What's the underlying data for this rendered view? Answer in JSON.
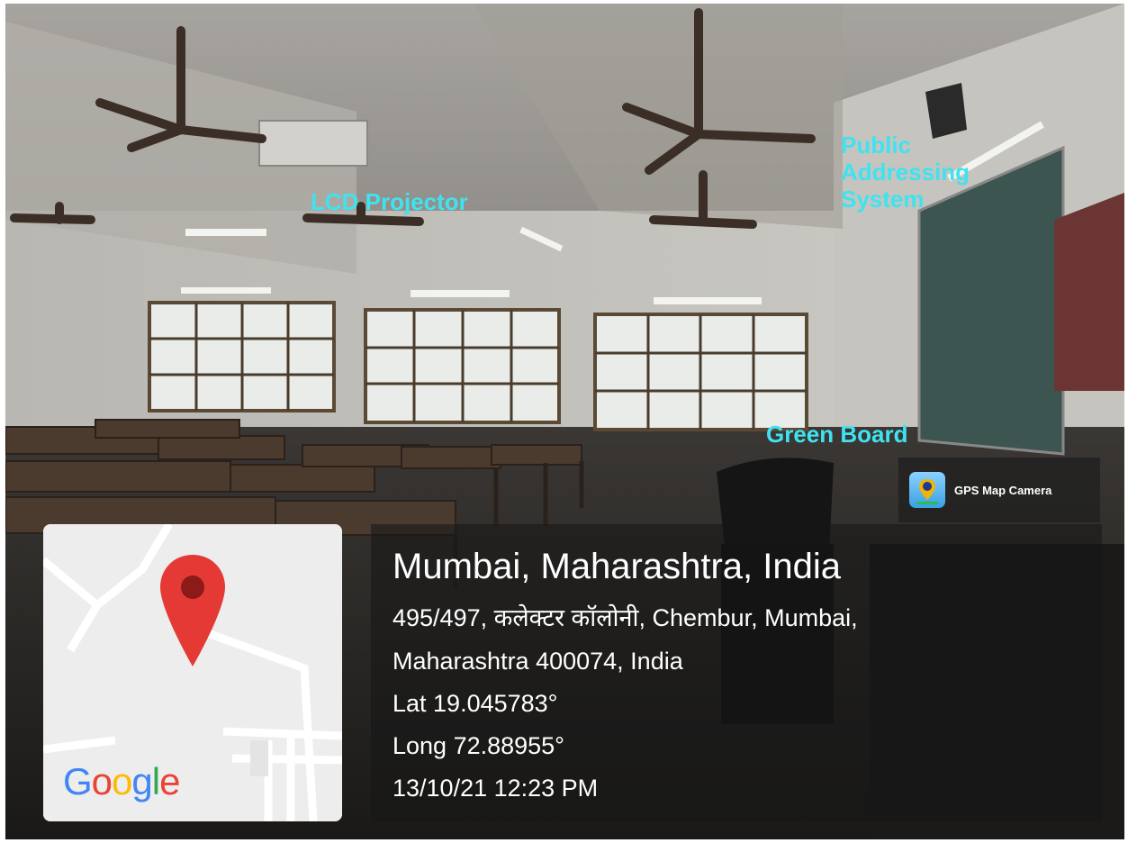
{
  "annotations": {
    "lcd_projector": "LCD Projector",
    "public_addressing": "Public\nAddressing\nSystem",
    "green_board": "Green Board"
  },
  "gps_badge": {
    "label": "GPS Map Camera",
    "icon": "gps-map-camera-app-icon"
  },
  "map": {
    "logo": "Google",
    "marker_icon": "map-pin-icon",
    "logo_colors": [
      "#4285F4",
      "#EA4335",
      "#FBBC05",
      "#4285F4",
      "#34A853",
      "#EA4335"
    ],
    "pin_color": "#e53935"
  },
  "location": {
    "title": "Mumbai, Maharashtra, India",
    "address_line1": "495/497, कलेक्टर कॉलोनी, Chembur, Mumbai,",
    "address_line2": "Maharashtra 400074, India",
    "lat": "Lat 19.045783°",
    "long": "Long 72.88955°",
    "datetime": "13/10/21 12:23 PM"
  },
  "colors": {
    "annotation": "#3fe3f0"
  }
}
